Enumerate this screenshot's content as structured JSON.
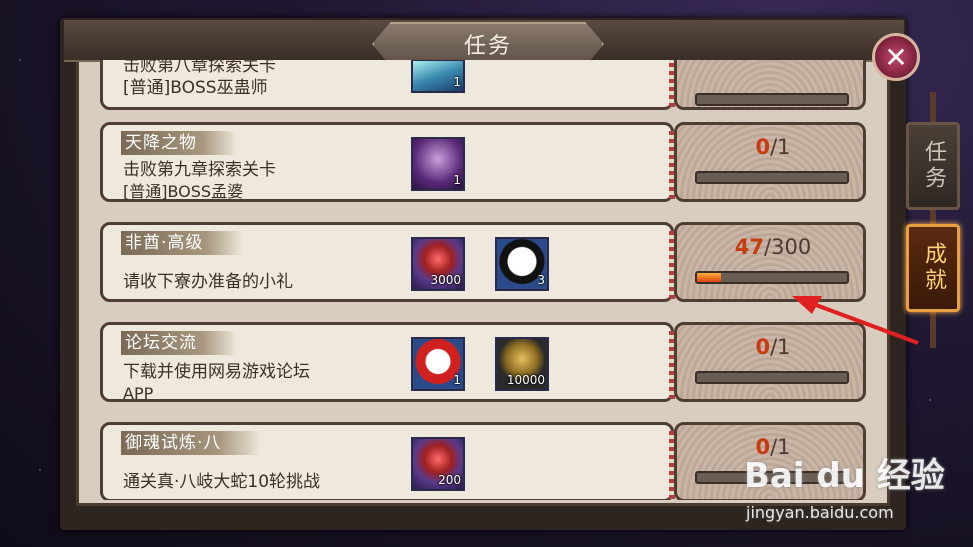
{
  "header": {
    "title": "任务",
    "close_label": "✕"
  },
  "side_tabs": [
    {
      "label": "任务",
      "active": false
    },
    {
      "label": "成就",
      "active": true
    }
  ],
  "tasks": [
    {
      "tag": "",
      "desc_lines": [
        "击败第八章探索关卡",
        "[普通]BOSS巫蛊师"
      ],
      "rewards": [
        {
          "icon": "fall-icon",
          "qty": "1"
        }
      ],
      "current": "",
      "total": "",
      "progress": 0
    },
    {
      "tag": "天降之物",
      "desc_lines": [
        "击败第九章探索关卡",
        "[普通]BOSS孟婆"
      ],
      "rewards": [
        {
          "icon": "boss-portrait-icon",
          "qty": "1"
        }
      ],
      "current": "0",
      "total": "/1",
      "progress": 0
    },
    {
      "tag": "非酋·高级",
      "desc_lines": [
        "请收下寮办准备的小礼"
      ],
      "rewards": [
        {
          "icon": "red-soul-icon",
          "qty": "3000"
        },
        {
          "icon": "white-daruma-icon",
          "qty": "3"
        }
      ],
      "current": "47",
      "total": "/300",
      "progress": 0.157
    },
    {
      "tag": "论坛交流",
      "desc_lines": [
        "下载并使用网易游戏论坛",
        "APP"
      ],
      "rewards": [
        {
          "icon": "red-daruma-icon",
          "qty": "1"
        },
        {
          "icon": "coin-icon",
          "qty": "10000"
        }
      ],
      "current": "0",
      "total": "/1",
      "progress": 0
    },
    {
      "tag": "御魂试炼·八",
      "desc_lines": [
        "通关真·八岐大蛇10轮挑战"
      ],
      "rewards": [
        {
          "icon": "red-soul-icon",
          "qty": "200"
        }
      ],
      "current": "0",
      "total": "/1",
      "progress": 0
    }
  ],
  "watermark": {
    "brand": "Bai du 经验",
    "url": "jingyan.baidu.com"
  },
  "colors": {
    "accent": "#c83a10",
    "panel": "#efe8dc",
    "frame": "#4e3d33"
  }
}
